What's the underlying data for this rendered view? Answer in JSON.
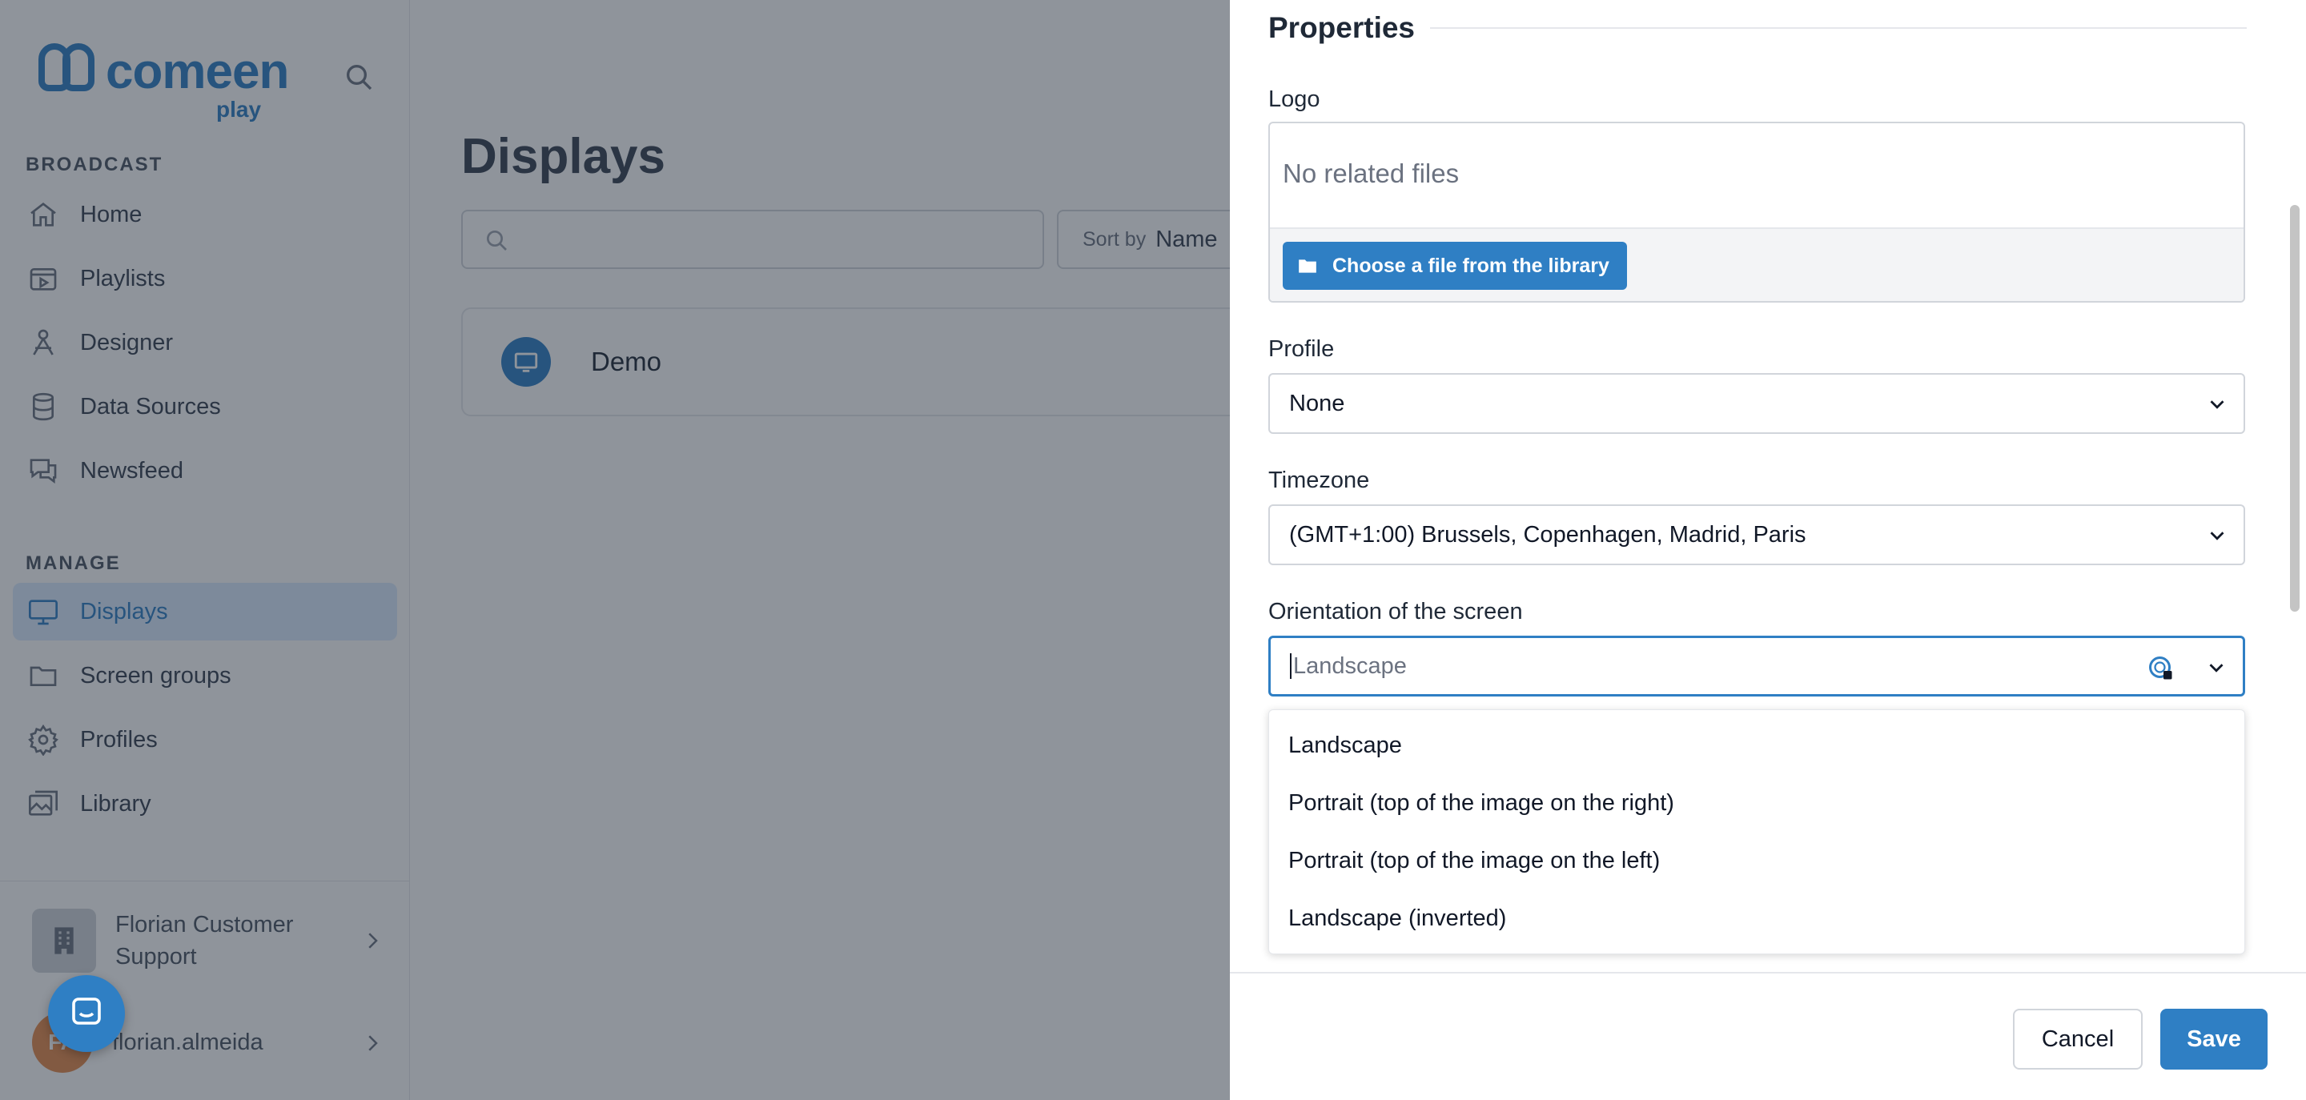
{
  "sidebar": {
    "logo_word": "comeen",
    "logo_sub": "play",
    "broadcast_label": "BROADCAST",
    "manage_label": "MANAGE",
    "broadcast_items": [
      {
        "label": "Home",
        "icon": "home-icon"
      },
      {
        "label": "Playlists",
        "icon": "playlist-icon"
      },
      {
        "label": "Designer",
        "icon": "designer-icon"
      },
      {
        "label": "Data Sources",
        "icon": "database-icon"
      },
      {
        "label": "Newsfeed",
        "icon": "chat-icon"
      }
    ],
    "manage_items": [
      {
        "label": "Displays",
        "icon": "monitor-icon",
        "active": true
      },
      {
        "label": "Screen groups",
        "icon": "folder-icon"
      },
      {
        "label": "Profiles",
        "icon": "gear-icon"
      },
      {
        "label": "Library",
        "icon": "images-icon"
      }
    ],
    "account_name": "Florian Customer Support",
    "user_initials": "FA",
    "user_name": "florian.almeida"
  },
  "main": {
    "title": "Displays",
    "sort_label": "Sort by",
    "sort_value": "Name",
    "displays": [
      {
        "name": "Demo"
      }
    ]
  },
  "drawer": {
    "section_title": "Properties",
    "logo_label": "Logo",
    "logo_empty": "No related files",
    "choose_file": "Choose a file from the library",
    "profile_label": "Profile",
    "profile_value": "None",
    "timezone_label": "Timezone",
    "timezone_value": "(GMT+1:00) Brussels, Copenhagen, Madrid, Paris",
    "orientation_label": "Orientation of the screen",
    "orientation_placeholder": "Landscape",
    "orientation_options": [
      "Landscape",
      "Portrait (top of the image on the right)",
      "Portrait (top of the image on the left)",
      "Landscape (inverted)"
    ],
    "cancel": "Cancel",
    "save": "Save"
  },
  "colors": {
    "brand": "#2f7fc4",
    "overlay": "#1f2937",
    "status_offline": "#dc2626"
  }
}
